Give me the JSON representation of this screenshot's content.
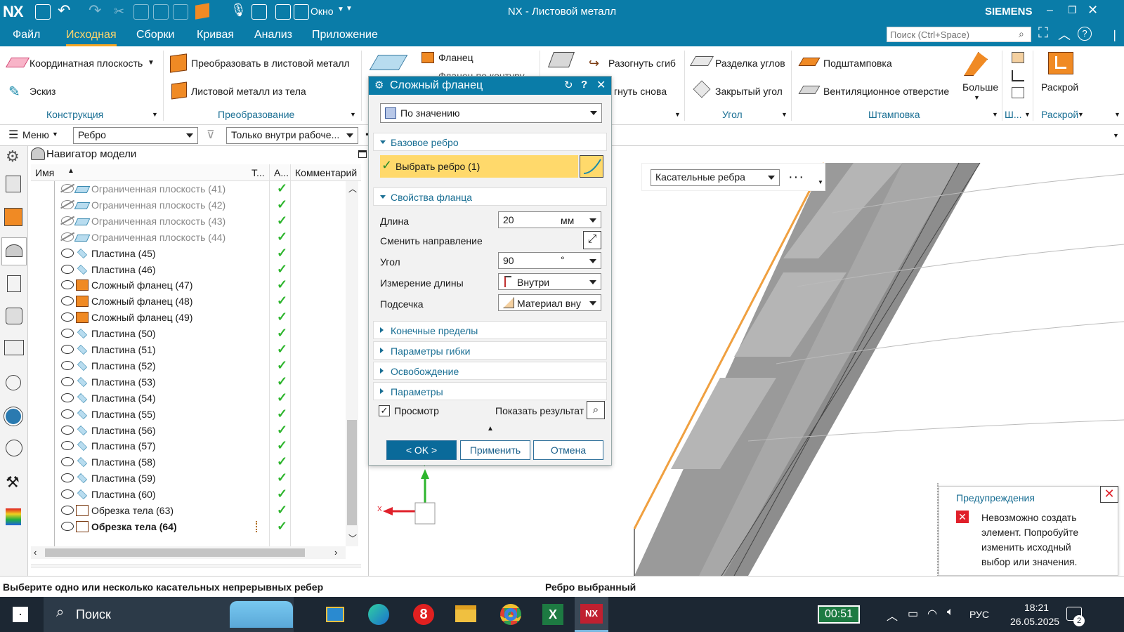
{
  "app": {
    "logo": "NX",
    "title": "NX - Листовой металл",
    "brand": "SIEMENS",
    "window_menu": "Окно",
    "search_placeholder": "Поиск (Ctrl+Space)"
  },
  "menu": [
    "Файл",
    "Исходная",
    "Сборки",
    "Кривая",
    "Анализ",
    "Приложение"
  ],
  "ribbon": {
    "construction": {
      "plane": "Координатная плоскость",
      "sketch": "Эскиз",
      "label": "Конструкция"
    },
    "transform": {
      "convert": "Преобразовать в листовой металл",
      "from_body": "Листовой металл из тела",
      "label": "Преобразование"
    },
    "flange": {
      "flange": "Фланец",
      "contour": "Фланец по контуру"
    },
    "bend": {
      "unbend": "Разогнуть сгиб",
      "rebend": "гнуть снова"
    },
    "corner": {
      "relief": "Разделка углов",
      "closed": "Закрытый угол",
      "label": "Угол"
    },
    "stamp": {
      "dimple": "Подштамповка",
      "louver": "Вентиляционное отверстие",
      "more": "Больше",
      "label": "Штамповка"
    },
    "short_group": "Ш...",
    "flat": {
      "button": "Раскрой",
      "label": "Раскрой"
    }
  },
  "selection_bar": {
    "menu": "Меню",
    "filter": "Ребро",
    "scope": "Только внутри рабоче..."
  },
  "navigator": {
    "title": "Навигатор модели",
    "columns": {
      "name": "Имя",
      "t": "Т...",
      "a": "А...",
      "comment": "Комментарий"
    },
    "rows": [
      {
        "label": "Ограниченная плоскость (41)",
        "type": "plane",
        "hidden": true,
        "bold": false
      },
      {
        "label": "Ограниченная плоскость (42)",
        "type": "plane",
        "hidden": true,
        "bold": false
      },
      {
        "label": "Ограниченная плоскость (43)",
        "type": "plane",
        "hidden": true,
        "bold": false
      },
      {
        "label": "Ограниченная плоскость (44)",
        "type": "plane",
        "hidden": true,
        "bold": false
      },
      {
        "label": "Пластина (45)",
        "type": "plate",
        "hidden": false,
        "bold": false
      },
      {
        "label": "Пластина (46)",
        "type": "plate",
        "hidden": false,
        "bold": false
      },
      {
        "label": "Сложный фланец (47)",
        "type": "flange",
        "hidden": false,
        "bold": false
      },
      {
        "label": "Сложный фланец (48)",
        "type": "flange",
        "hidden": false,
        "bold": false
      },
      {
        "label": "Сложный фланец (49)",
        "type": "flange",
        "hidden": false,
        "bold": false
      },
      {
        "label": "Пластина (50)",
        "type": "plate",
        "hidden": false,
        "bold": false
      },
      {
        "label": "Пластина (51)",
        "type": "plate",
        "hidden": false,
        "bold": false
      },
      {
        "label": "Пластина (52)",
        "type": "plate",
        "hidden": false,
        "bold": false
      },
      {
        "label": "Пластина (53)",
        "type": "plate",
        "hidden": false,
        "bold": false
      },
      {
        "label": "Пластина (54)",
        "type": "plate",
        "hidden": false,
        "bold": false
      },
      {
        "label": "Пластина (55)",
        "type": "plate",
        "hidden": false,
        "bold": false
      },
      {
        "label": "Пластина (56)",
        "type": "plate",
        "hidden": false,
        "bold": false
      },
      {
        "label": "Пластина (57)",
        "type": "plate",
        "hidden": false,
        "bold": false
      },
      {
        "label": "Пластина (58)",
        "type": "plate",
        "hidden": false,
        "bold": false
      },
      {
        "label": "Пластина (59)",
        "type": "plate",
        "hidden": false,
        "bold": false
      },
      {
        "label": "Пластина (60)",
        "type": "plate",
        "hidden": false,
        "bold": false
      },
      {
        "label": "Обрезка тела (63)",
        "type": "trim",
        "hidden": false,
        "bold": false
      },
      {
        "label": "Обрезка тела (64)",
        "type": "trim",
        "hidden": false,
        "bold": true
      }
    ]
  },
  "dialog": {
    "title": "Сложный фланец",
    "type_dropdown": "По значению",
    "base_edge": {
      "header": "Базовое ребро",
      "select": "Выбрать ребро (1)"
    },
    "props": {
      "header": "Свойства фланца",
      "length_label": "Длина",
      "length_value": "20",
      "length_unit": "мм",
      "reverse_label": "Сменить направление",
      "angle_label": "Угол",
      "angle_value": "90",
      "angle_unit": "°",
      "measure_label": "Измерение длины",
      "measure_value": "Внутри",
      "inset_label": "Подсечка",
      "inset_value": "Материал вну"
    },
    "collapsed": [
      "Конечные пределы",
      "Параметры гибки",
      "Освобождение",
      "Параметры"
    ],
    "preview_label": "Просмотр",
    "show_result": "Показать результат",
    "ok": "< OK >",
    "apply": "Применить",
    "cancel": "Отмена"
  },
  "viewport": {
    "edge_filter": "Касательные ребра",
    "axis_x": "X",
    "axis_y": "Y"
  },
  "warning": {
    "title": "Предупреждения",
    "message": "Невозможно создать элемент. Попробуйте изменить исходный выбор или значения."
  },
  "status": {
    "left": "Выберите одно или несколько касательных непрерывных ребер",
    "center": "Ребро выбранный"
  },
  "taskbar": {
    "search": "Поиск",
    "battery": "00:51",
    "lang": "РУС",
    "time": "18:21",
    "date": "26.05.2025",
    "notif": "2"
  },
  "colors": {
    "accent": "#0a7ca8",
    "highlight": "#ffd96b",
    "edge": "#f0a040",
    "check": "#2db52d",
    "error": "#e0202a"
  }
}
